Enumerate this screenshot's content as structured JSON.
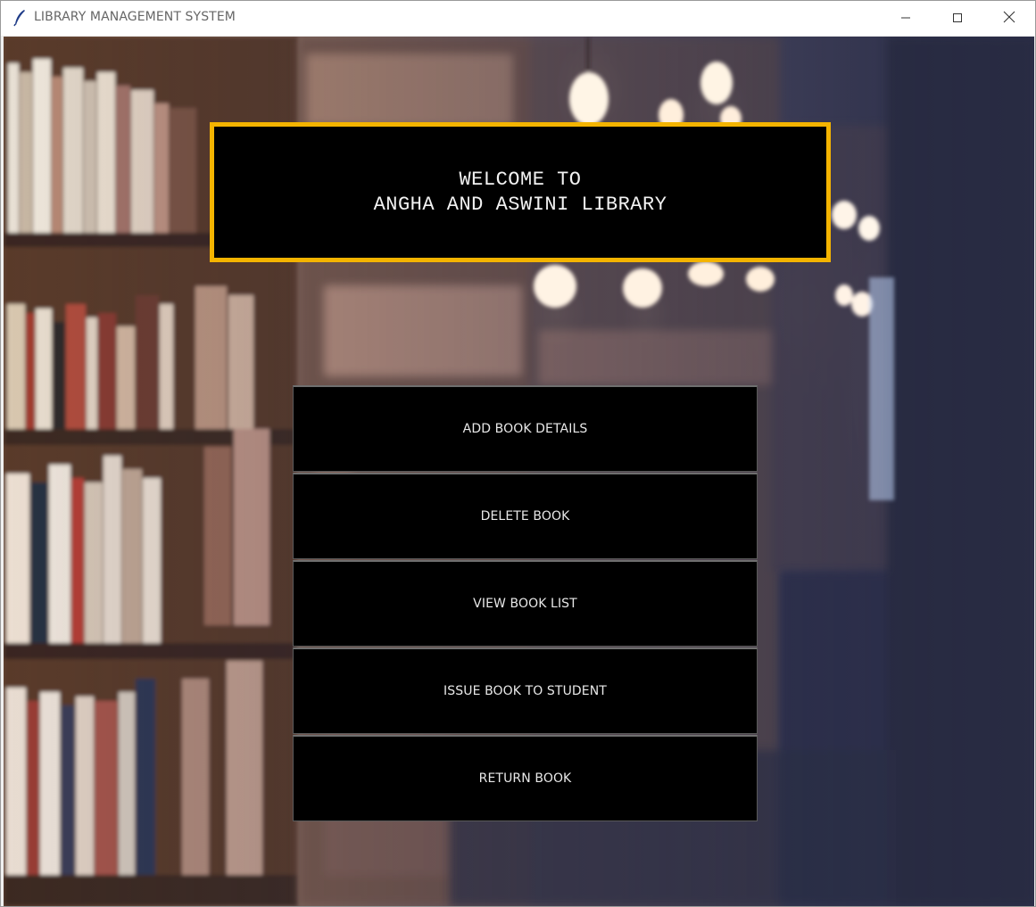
{
  "window": {
    "title": "LIBRARY MANAGEMENT SYSTEM",
    "app_icon": "feather-icon",
    "controls": {
      "minimize_icon": "minimize-icon",
      "maximize_icon": "maximize-icon",
      "close_icon": "close-icon"
    }
  },
  "banner": {
    "line1": "WELCOME TO",
    "line2": "ANGHA AND ASWINI LIBRARY",
    "border_color": "#f4b400",
    "background": "#000000"
  },
  "menu": {
    "buttons": [
      {
        "label": "ADD BOOK DETAILS"
      },
      {
        "label": "DELETE BOOK"
      },
      {
        "label": "VIEW BOOK LIST"
      },
      {
        "label": "ISSUE BOOK TO STUDENT"
      },
      {
        "label": "RETURN BOOK"
      }
    ]
  },
  "background": {
    "description_icon": "library-bookshelf-photo"
  }
}
